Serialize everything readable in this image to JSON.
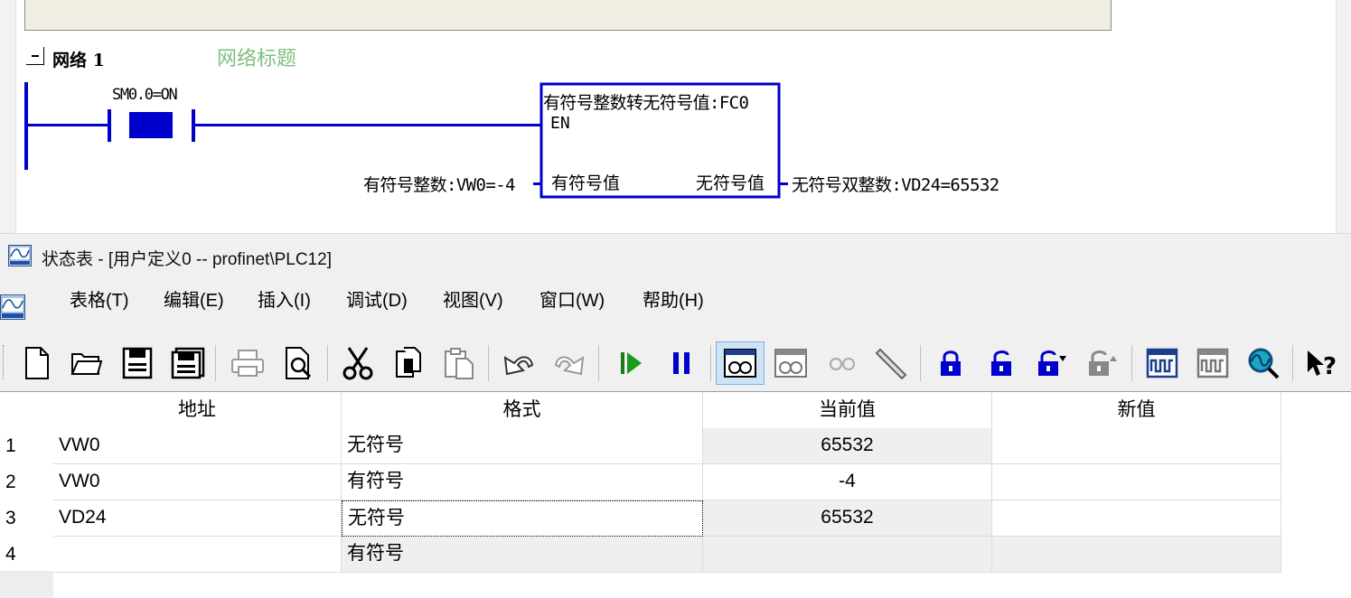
{
  "ladder": {
    "network_label": "网络 1",
    "network_title": "网络标题",
    "contact_label": "SM0.0=ON",
    "function_block": {
      "title": "有符号整数转无符号值:FC0",
      "en_label": "EN",
      "input_label": "有符号值",
      "output_label": "无符号值"
    },
    "input_operand": "有符号整数:VW0=-4",
    "output_operand": "无符号双整数:VD24=65532",
    "rung_color": "#0000cc"
  },
  "window": {
    "title": "状态表 - [用户定义0 -- profinet\\PLC12]"
  },
  "menu": [
    "表格(T)",
    "编辑(E)",
    "插入(I)",
    "调试(D)",
    "视图(V)",
    "窗口(W)",
    "帮助(H)"
  ],
  "toolbar": [
    {
      "icon": "new-file-icon"
    },
    {
      "icon": "open-folder-icon"
    },
    {
      "icon": "save-icon"
    },
    {
      "icon": "save-all-icon"
    },
    {
      "icon": "print-icon"
    },
    {
      "icon": "print-preview-icon"
    },
    {
      "icon": "cut-icon"
    },
    {
      "icon": "copy-icon"
    },
    {
      "icon": "paste-icon"
    },
    {
      "icon": "undo-icon"
    },
    {
      "icon": "redo-icon"
    },
    {
      "icon": "run-icon"
    },
    {
      "icon": "pause-icon"
    },
    {
      "icon": "chart-status-icon",
      "pressed": true
    },
    {
      "icon": "single-read-icon"
    },
    {
      "icon": "write-all-icon",
      "disabled": true
    },
    {
      "icon": "pen-icon"
    },
    {
      "icon": "force-lock-icon"
    },
    {
      "icon": "unforce-icon"
    },
    {
      "icon": "unforce-all-icon"
    },
    {
      "icon": "read-all-forced-icon",
      "disabled": true
    },
    {
      "icon": "trend-view-icon"
    },
    {
      "icon": "trend-pause-icon",
      "disabled": true
    },
    {
      "icon": "search-icon"
    },
    {
      "icon": "context-help-icon"
    }
  ],
  "table": {
    "columns": [
      "地址",
      "格式",
      "当前值",
      "新值"
    ],
    "rows": [
      {
        "num": "1",
        "address": "VW0",
        "format": "无符号",
        "current": "65532",
        "new": ""
      },
      {
        "num": "2",
        "address": "VW0",
        "format": "有符号",
        "current": "-4",
        "new": ""
      },
      {
        "num": "3",
        "address": "VD24",
        "format": "无符号",
        "current": "65532",
        "new": ""
      },
      {
        "num": "4",
        "address": "",
        "format": "有符号",
        "current": "",
        "new": ""
      }
    ]
  },
  "colors": {
    "rung_blue": "#0000cc",
    "network_title_green": "#7fbf7f",
    "grid_gray": "#efefef"
  }
}
